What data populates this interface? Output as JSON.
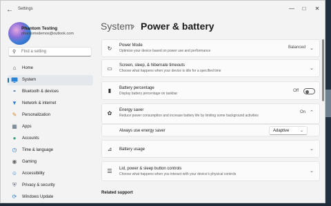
{
  "window": {
    "title": "Settings"
  },
  "profile": {
    "name": "Phantom Testing",
    "email": "phantomsdemos@outlook.com"
  },
  "search": {
    "placeholder": "Find a setting"
  },
  "sidebar": {
    "items": [
      {
        "label": "Home",
        "icon": "home-icon",
        "active": false
      },
      {
        "label": "System",
        "icon": "system-icon",
        "active": true
      },
      {
        "label": "Bluetooth & devices",
        "icon": "bluetooth-icon",
        "active": false
      },
      {
        "label": "Network & internet",
        "icon": "wifi-icon",
        "active": false
      },
      {
        "label": "Personalization",
        "icon": "brush-icon",
        "active": false
      },
      {
        "label": "Apps",
        "icon": "apps-icon",
        "active": false
      },
      {
        "label": "Accounts",
        "icon": "person-icon",
        "active": false
      },
      {
        "label": "Time & language",
        "icon": "globe-clock-icon",
        "active": false
      },
      {
        "label": "Gaming",
        "icon": "controller-icon",
        "active": false
      },
      {
        "label": "Accessibility",
        "icon": "accessibility-icon",
        "active": false
      },
      {
        "label": "Privacy & security",
        "icon": "shield-icon",
        "active": false
      },
      {
        "label": "Windows Update",
        "icon": "update-icon",
        "active": false
      }
    ]
  },
  "header": {
    "breadcrumb_parent": "System",
    "separator": "›",
    "page_title": "Power & battery"
  },
  "power_mode": {
    "title": "Power Mode",
    "subtitle": "Optimize your device based on power use and performance",
    "value": "Balanced"
  },
  "screen_sleep": {
    "title": "Screen, sleep, & hibernate timeouts",
    "subtitle": "Choose what happens when your device is idle for a specified time"
  },
  "battery_percentage": {
    "title": "Battery percentage",
    "subtitle": "Display battery percentage on taskbar",
    "state": "Off"
  },
  "energy_saver": {
    "title": "Energy saver",
    "subtitle": "Reduce power consumption and increase battery life by limiting some background activities",
    "state": "On",
    "always_use_label": "Always use energy saver",
    "dropdown_value": "Adaptive"
  },
  "battery_usage": {
    "title": "Battery usage"
  },
  "lid_controls": {
    "title": "Lid, power & sleep button controls",
    "subtitle": "Choose what happens when you interact with your device's physical controls"
  },
  "related": {
    "label": "Related support"
  },
  "colors": {
    "accent": "#1f6fb2",
    "window_bg": "#f3f3f3",
    "card_bg": "#fbfbfb"
  }
}
